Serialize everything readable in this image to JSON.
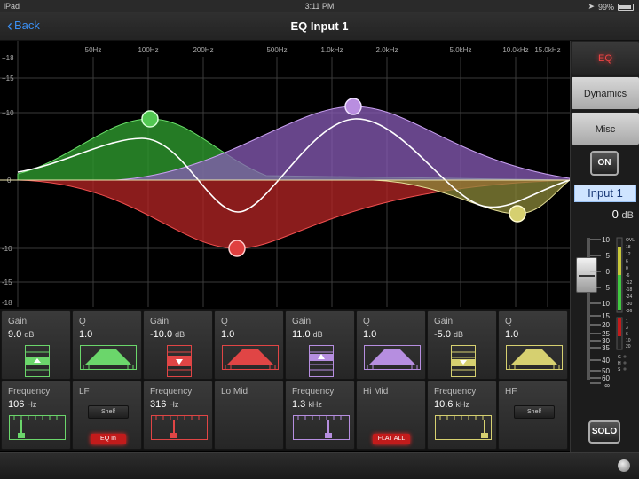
{
  "status": {
    "device": "iPad",
    "time": "3:11 PM",
    "battery": "99%"
  },
  "nav": {
    "back": "Back",
    "title": "EQ Input 1"
  },
  "graph": {
    "freq_labels": [
      "50Hz",
      "100Hz",
      "200Hz",
      "500Hz",
      "1.0kHz",
      "2.0kHz",
      "5.0kHz",
      "10.0kHz",
      "15.0kHz"
    ],
    "db_labels": [
      "+18",
      "+15",
      "+10",
      "0",
      "-10",
      "-15",
      "-18"
    ]
  },
  "bands": {
    "lf": {
      "color": "#46c246",
      "gain": "9.0",
      "q": "1.0",
      "freq": "106"
    },
    "lm": {
      "color": "#d83535",
      "gain": "-10.0",
      "q": "1.0",
      "freq": "316"
    },
    "hm": {
      "color": "#a87cd4",
      "gain": "11.0",
      "q": "1.0",
      "freq": "1.3"
    },
    "hf": {
      "color": "#c8c26c",
      "gain": "-5.0",
      "q": "1.0",
      "freq": "10.6"
    }
  },
  "params": {
    "gain_label": "Gain",
    "q_label": "Q",
    "freq_label": "Frequency",
    "db_unit": "dB",
    "hz_unit": "Hz",
    "khz_unit": "kHz",
    "lf_label": "LF",
    "lm_label": "Lo Mid",
    "hm_label": "Hi Mid",
    "hf_label": "HF",
    "shelf": "Shelf",
    "eq_in": "EQ In",
    "flat_all": "FLAT ALL"
  },
  "side": {
    "eq": "EQ",
    "dynamics": "Dynamics",
    "misc": "Misc",
    "on": "ON",
    "channel": "Input 1",
    "level": "0",
    "level_unit": "dB",
    "solo": "SOLO",
    "fader_scale": [
      "10",
      "5",
      "0",
      "5",
      "10",
      "15",
      "20",
      "25",
      "30",
      "35",
      "40",
      "50",
      "60",
      "∞"
    ],
    "meter_scale": [
      "OVL",
      "18",
      "12",
      "6",
      "0",
      "-6",
      "-12",
      "-18",
      "-24",
      "-30",
      "-36"
    ],
    "gr_scale": [
      "1",
      "3",
      "6",
      "10",
      "20"
    ],
    "gr_letters": [
      "G",
      "H",
      "S"
    ]
  }
}
